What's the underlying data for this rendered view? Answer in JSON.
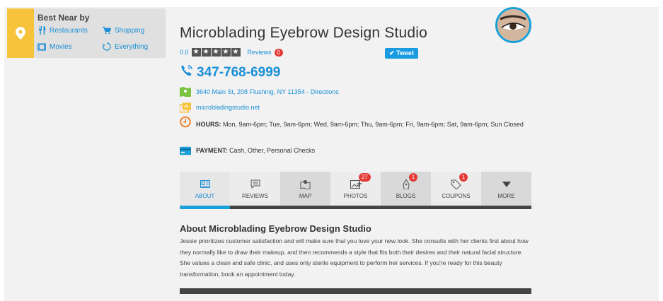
{
  "nearby": {
    "title": "Best Near by",
    "links": [
      {
        "label": "Restaurants",
        "icon": "fork-knife-icon"
      },
      {
        "label": "Shopping",
        "icon": "cart-icon"
      },
      {
        "label": "Movies",
        "icon": "film-icon"
      },
      {
        "label": "Everything",
        "icon": "circle-arrows-icon"
      }
    ]
  },
  "business": {
    "name": "Microblading Eyebrow Design Studio",
    "rating": "0.0",
    "reviews_label": "Reviews",
    "reviews_count": "0",
    "tweet_label": "Tweet",
    "phone": "347-768-6999",
    "address": "3640 Main St, 208 Flushing, NY 11354 - Directions",
    "website": "microbladingstudio.net",
    "hours_label": "HOURS:",
    "hours": "Mon, 9am-6pm; Tue, 9am-6pm; Wed, 9am-6pm; Thu, 9am-6pm; Fri, 9am-6pm; Sat, 9am-6pm; Sun Closed",
    "payment_label": "PAYMENT:",
    "payment": "Cash, Other, Personal Checks"
  },
  "tabs": [
    {
      "label": "ABOUT",
      "badge": ""
    },
    {
      "label": "REVIEWS",
      "badge": ""
    },
    {
      "label": "MAP",
      "badge": ""
    },
    {
      "label": "PHOTOS",
      "badge": "27"
    },
    {
      "label": "BLOGS",
      "badge": "1"
    },
    {
      "label": "COUPONS",
      "badge": "1"
    },
    {
      "label": "MORE",
      "badge": ""
    }
  ],
  "about": {
    "heading": "About Microblading Eyebrow Design Studio",
    "text": "Jessie prioritizes customer satisfaction and will make sure that you love your new look. She consults with her clients first about how they normally like to draw their makeup, and then recommends a style that fits both their desires and their natural facial structure. She values a clean and safe clinic, and uses only sterile equipment to perform her services. If you're ready for this beauty transformation, book an appointment today."
  },
  "colors": {
    "accent": "#1a8fd6",
    "pin": "#f6c33a",
    "badge": "#e53935",
    "tweet": "#1a9be0"
  }
}
